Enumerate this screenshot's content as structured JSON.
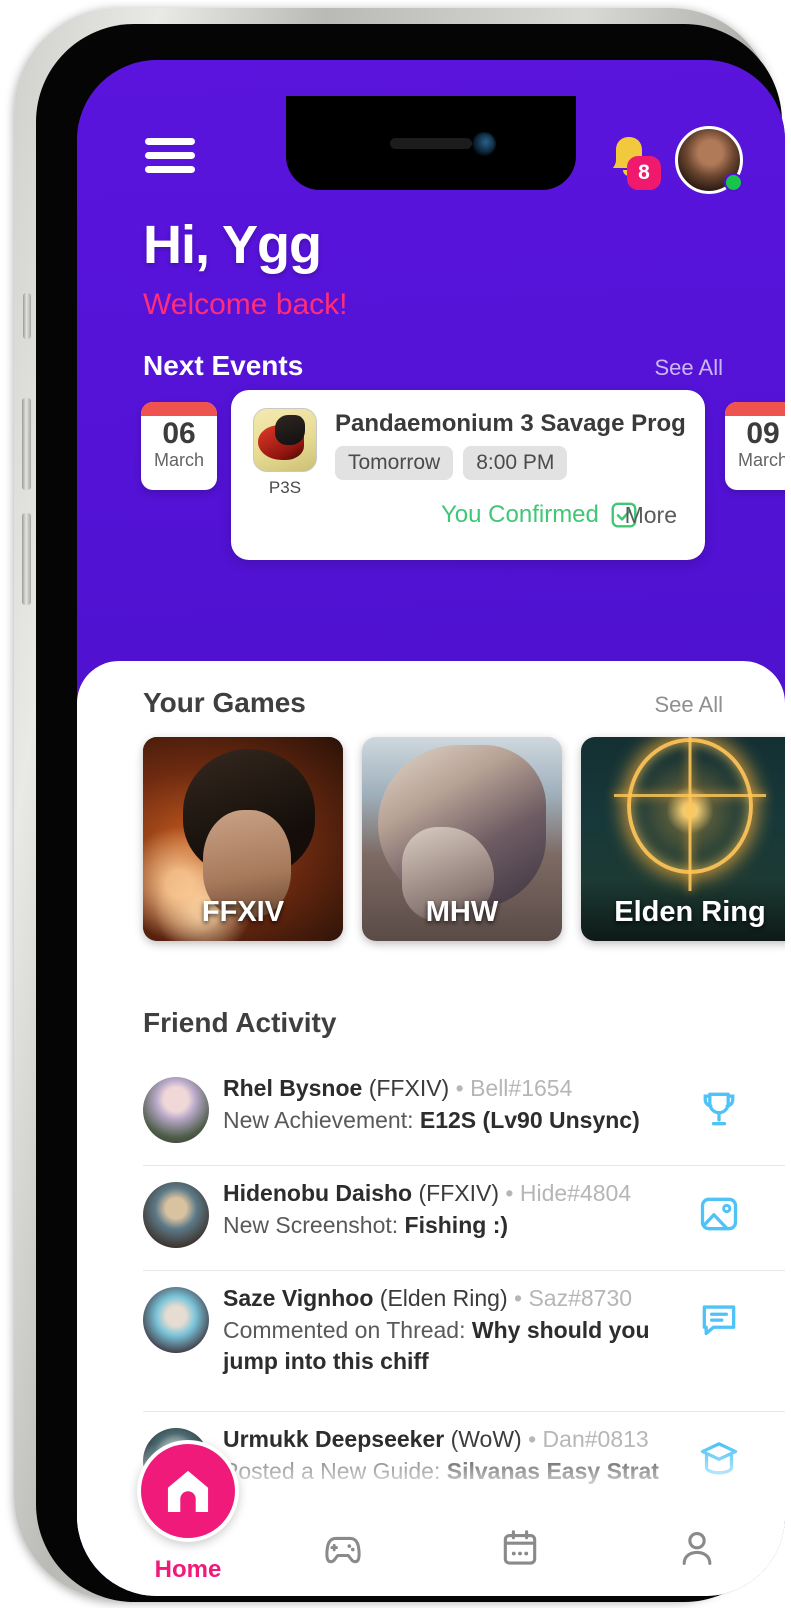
{
  "header": {
    "menu_icon": "hamburger-menu-icon",
    "bell_icon": "notification-bell-icon",
    "notification_count": "8",
    "avatar_icon": "user-avatar",
    "status": "online",
    "greeting": "Hi, Ygg",
    "welcome": "Welcome back!"
  },
  "next_events": {
    "title": "Next Events",
    "see_all": "See All",
    "cards": [
      {
        "day": "06",
        "month": "March",
        "game_icon_label": "P3S",
        "title": "Pandaemonium 3 Savage Prog",
        "day_chip": "Tomorrow",
        "time_chip": "8:00 PM",
        "status": "You Confirmed",
        "status_icon": "check-square-icon",
        "more": "More"
      },
      {
        "day": "09",
        "month": "March"
      }
    ]
  },
  "your_games": {
    "title": "Your Games",
    "see_all": "See All",
    "cards": [
      {
        "label": "FFXIV"
      },
      {
        "label": "MHW"
      },
      {
        "label": "Elden Ring"
      }
    ]
  },
  "friend_activity": {
    "title": "Friend Activity",
    "rows": [
      {
        "name": "Rhel Bysnoe",
        "game": "(FFXIV)",
        "dot": "•",
        "tag": "Bell#1654",
        "action": "New Achievement: ",
        "detail": "E12S (Lv90 Unsync)",
        "icon": "trophy-icon"
      },
      {
        "name": "Hidenobu Daisho",
        "game": "(FFXIV)",
        "dot": "•",
        "tag": "Hide#4804",
        "action": "New Screenshot: ",
        "detail": "Fishing :)",
        "icon": "image-icon"
      },
      {
        "name": "Saze Vignhoo",
        "game": "(Elden Ring)",
        "dot": "•",
        "tag": "Saz#8730",
        "action": "Commented on Thread: ",
        "detail": "Why should you jump into this chiff",
        "icon": "comment-icon"
      },
      {
        "name": "Urmukk Deepseeker",
        "game": "(WoW)",
        "dot": "•",
        "tag": "Dan#0813",
        "action": "Posted a New Guide: ",
        "detail": "Silvanas Easy Strat",
        "icon": "book-icon"
      }
    ]
  },
  "bottom_nav": {
    "items": [
      {
        "label": "Home",
        "icon": "home-icon",
        "active": true
      },
      {
        "label": "",
        "icon": "gamepad-icon",
        "active": false
      },
      {
        "label": "",
        "icon": "calendar-icon",
        "active": false
      },
      {
        "label": "",
        "icon": "person-icon",
        "active": false
      }
    ]
  },
  "colors": {
    "purple": "#5212d4",
    "pink": "#ef1a7a",
    "welcome_pink": "#ff2d78",
    "green": "#3fc776",
    "icon_blue": "#4fc3f7"
  }
}
